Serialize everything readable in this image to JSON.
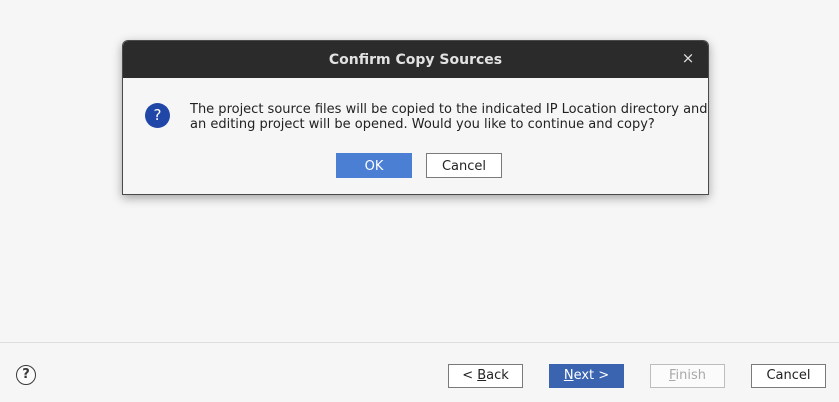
{
  "wizard": {
    "help_icon": "question-circle-icon",
    "help_glyph": "?",
    "buttons": {
      "back_prefix": "< ",
      "back_mnemonic": "B",
      "back_rest": "ack",
      "next_mnemonic": "N",
      "next_rest": "ext >",
      "finish_mnemonic": "F",
      "finish_rest": "inish",
      "cancel": "Cancel"
    },
    "colors": {
      "primary": "#3a64b0",
      "disabled_text": "#a9a9a9"
    }
  },
  "dialog": {
    "title": "Confirm Copy Sources",
    "close_glyph": "×",
    "icon": "question-icon",
    "icon_glyph": "?",
    "message_lines": [
      "The project source files will be copied to the indicated IP Location directory and",
      "an editing project will be opened. Would you like to continue and copy?"
    ],
    "ok_label": "OK",
    "cancel_label": "Cancel",
    "colors": {
      "titlebar": "#2b2b2b",
      "ok_button": "#4a7fd4",
      "icon": "#2046a8"
    }
  }
}
